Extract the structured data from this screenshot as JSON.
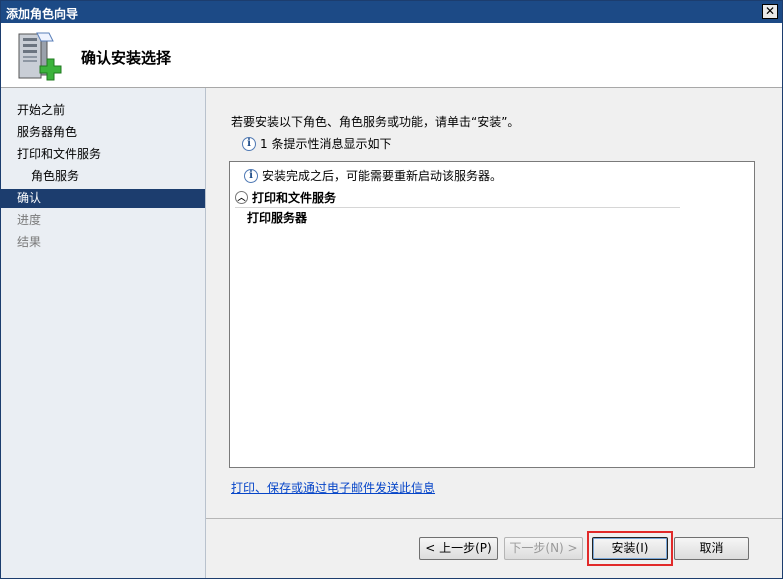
{
  "window": {
    "title": "添加角色向导",
    "close_label": "✕"
  },
  "header": {
    "icon": "server-add-icon",
    "title": "确认安装选择"
  },
  "sidebar": {
    "items": [
      {
        "label": "开始之前",
        "state": "normal"
      },
      {
        "label": "服务器角色",
        "state": "normal"
      },
      {
        "label": "打印和文件服务",
        "state": "normal"
      },
      {
        "label": "角色服务",
        "state": "sub"
      },
      {
        "label": "确认",
        "state": "active"
      },
      {
        "label": "进度",
        "state": "disabled"
      },
      {
        "label": "结果",
        "state": "disabled"
      }
    ]
  },
  "main": {
    "intro": "若要安装以下角色、角色服务或功能，请单击“安装”。",
    "info_count": "1 条提示性消息显示如下",
    "list": {
      "note": "安装完成之后，可能需要重新启动该服务器。",
      "section_title": "打印和文件服务",
      "item": "打印服务器"
    },
    "link": "打印、保存或通过电子邮件发送此信息"
  },
  "buttons": {
    "back": "< 上一步(P)",
    "next": "下一步(N) >",
    "install": "安装(I)",
    "cancel": "取消"
  },
  "colors": {
    "titlebar": "#1c4a86",
    "active_nav": "#1c3d6e",
    "highlight": "#e12a2a",
    "link": "#0645c8"
  }
}
